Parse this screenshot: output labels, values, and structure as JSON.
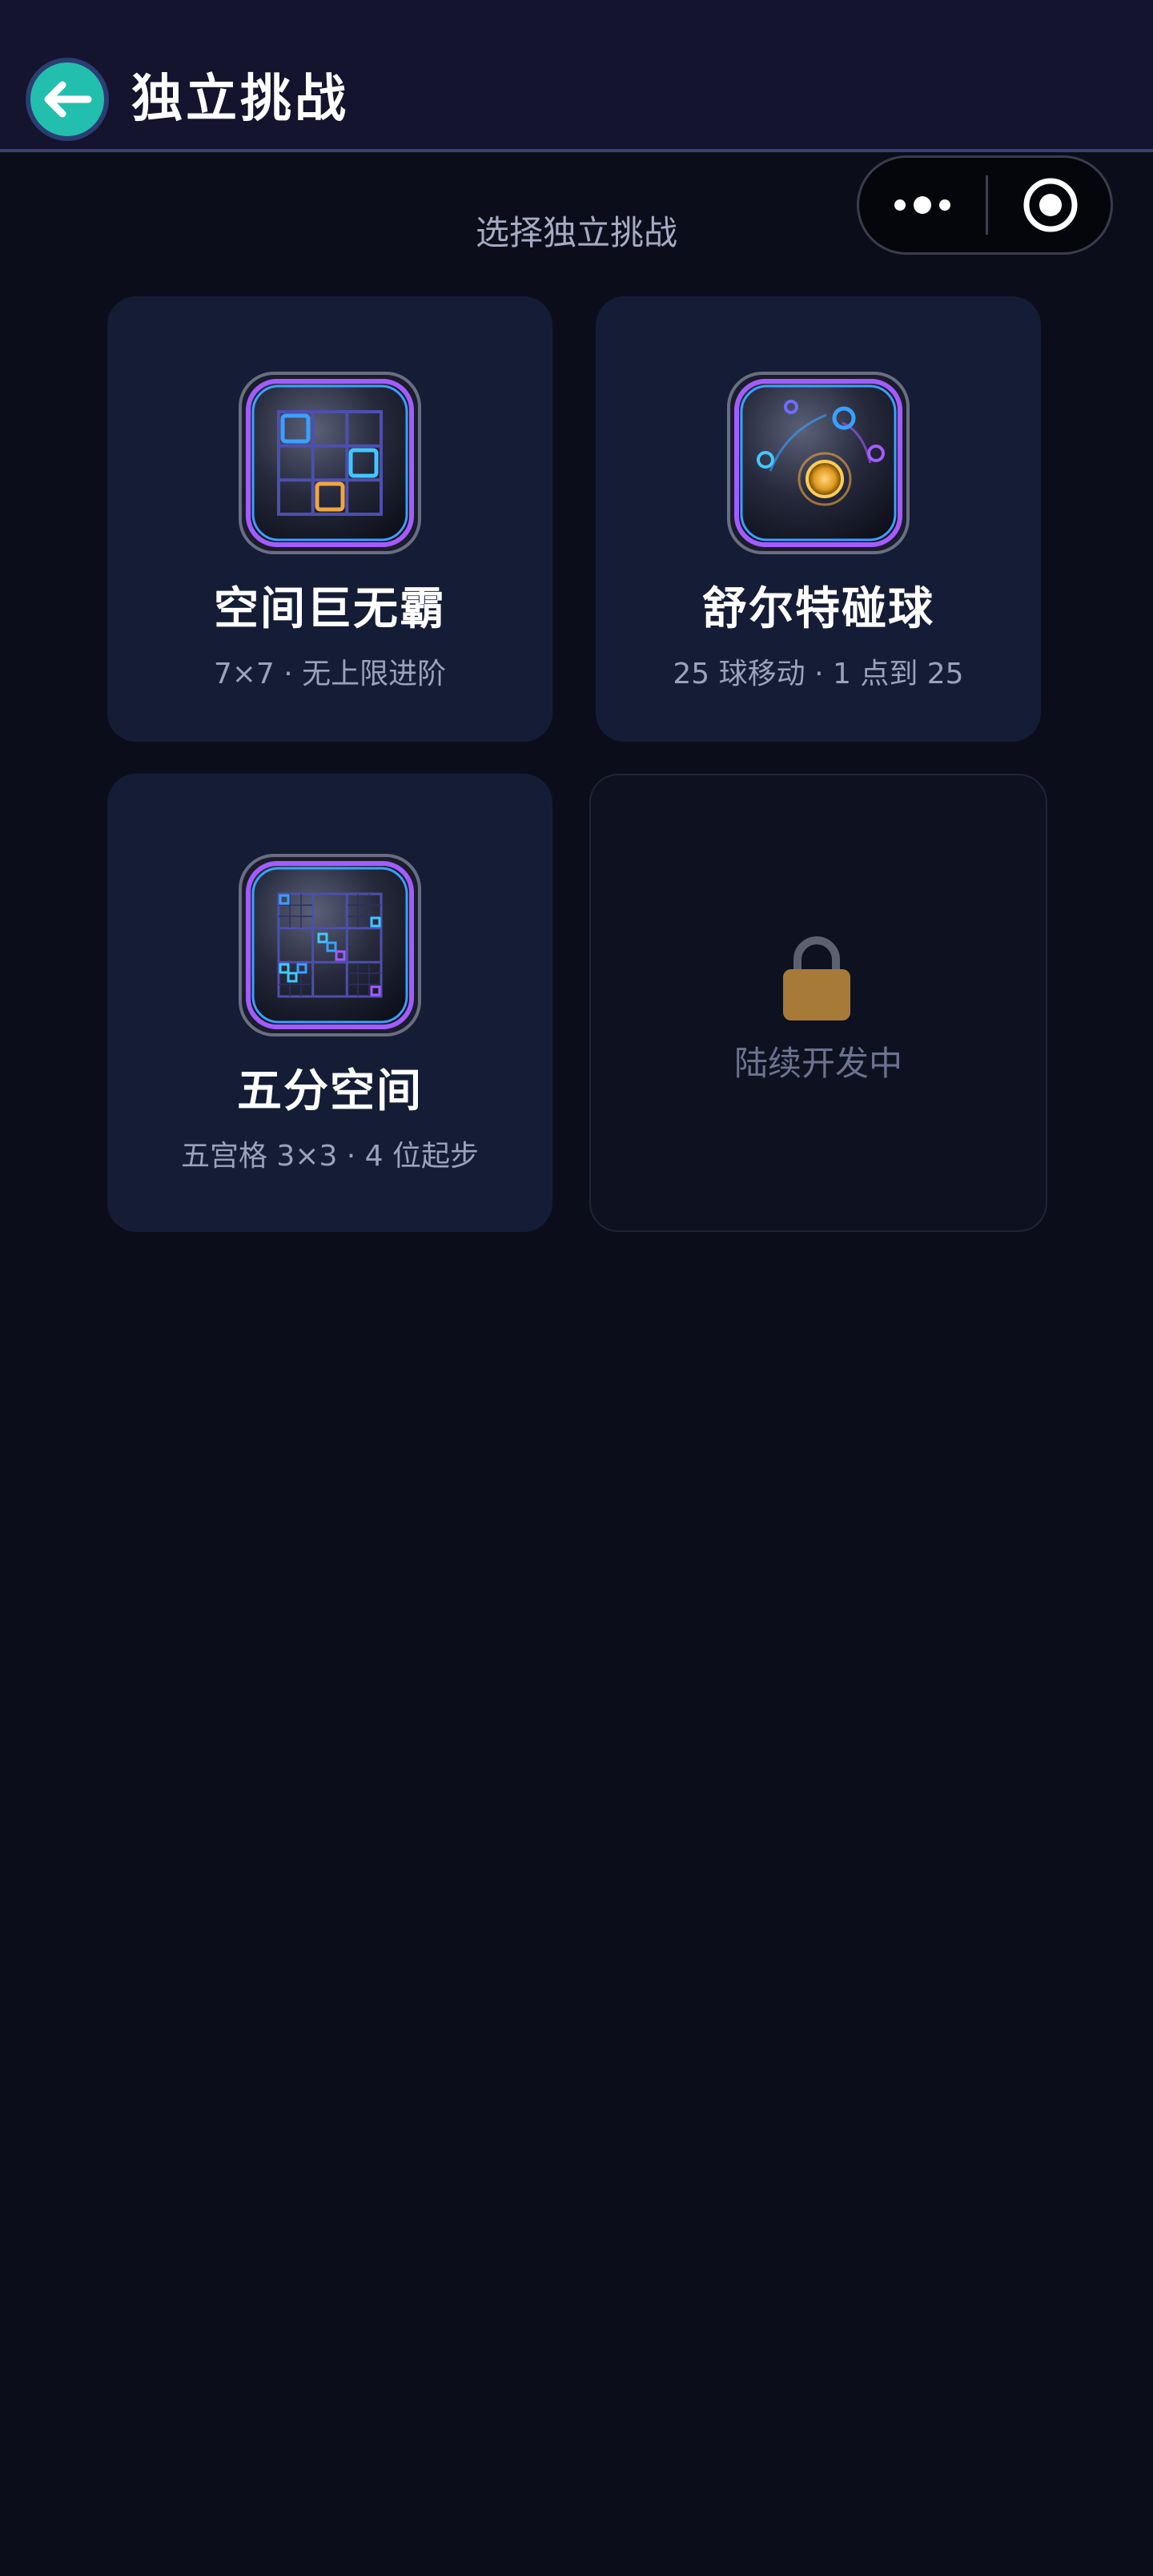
{
  "header": {
    "title": "独立挑战"
  },
  "subtitle": "选择独立挑战",
  "challenges": [
    {
      "title": "空间巨无霸",
      "desc": "7×7 · 无上限进阶",
      "icon": "grid-puzzle-icon"
    },
    {
      "title": "舒尔特碰球",
      "desc": "25 球移动 · 1 点到 25",
      "icon": "bouncing-balls-icon"
    },
    {
      "title": "五分空间",
      "desc": "五宫格 3×3 · 4 位起步",
      "icon": "five-grid-icon"
    }
  ],
  "locked_card": {
    "label": "陆续开发中",
    "icon": "lock-icon"
  },
  "colors": {
    "background": "#0b0e1a",
    "header_bg": "#14142e",
    "card_bg": "#151d36",
    "back_button": "#22bfae",
    "lock_body": "#a87a38",
    "neon_blue": "#3aa0ff",
    "neon_purple": "#a35cff",
    "neon_orange": "#f0a640"
  }
}
